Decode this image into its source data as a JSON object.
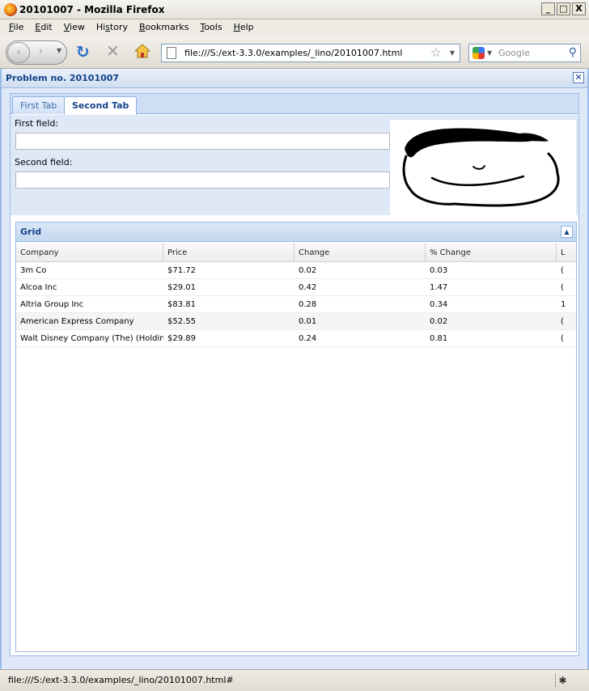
{
  "window": {
    "title": "20101007 - Mozilla Firefox",
    "controls": {
      "minimize": "_",
      "maximize": "□",
      "close": "X"
    }
  },
  "menu": {
    "items": [
      {
        "label": "File",
        "key": "F",
        "rest": "ile"
      },
      {
        "label": "Edit",
        "key": "E",
        "rest": "dit"
      },
      {
        "label": "View",
        "key": "V",
        "rest": "iew"
      },
      {
        "label": "History",
        "key": "s",
        "before": "Hi",
        "rest": "tory"
      },
      {
        "label": "Bookmarks",
        "key": "B",
        "rest": "ookmarks"
      },
      {
        "label": "Tools",
        "key": "T",
        "rest": "ools"
      },
      {
        "label": "Help",
        "key": "H",
        "rest": "elp"
      }
    ]
  },
  "toolbar": {
    "back_icon": "‹",
    "forward_icon": "›",
    "dropdown_icon": "▼",
    "reload_icon": "↻",
    "stop_icon": "✕",
    "url": "file:///S:/ext-3.3.0/examples/_lino/20101007.html",
    "star_icon": "☆",
    "url_dropdown_icon": "▼",
    "search_placeholder": "Google",
    "search_icon": "⚲"
  },
  "ext_window": {
    "title": "Problem no. 20101007",
    "close_icon": "✕",
    "tabs": [
      {
        "label": "First Tab",
        "active": false
      },
      {
        "label": "Second Tab",
        "active": true
      }
    ],
    "form": {
      "first_label": "First field:",
      "first_value": "",
      "second_label": "Second field:",
      "second_value": ""
    },
    "grid": {
      "title": "Grid",
      "collapse_icon": "▲",
      "columns": [
        "Company",
        "Price",
        "Change",
        "% Change",
        "L"
      ],
      "rows": [
        [
          "3m Co",
          "$71.72",
          "0.02",
          "0.03",
          "("
        ],
        [
          "Alcoa Inc",
          "$29.01",
          "0.42",
          "1.47",
          "("
        ],
        [
          "Altria Group Inc",
          "$83.81",
          "0.28",
          "0.34",
          "1"
        ],
        [
          "American Express Company",
          "$52.55",
          "0.01",
          "0.02",
          "("
        ],
        [
          "Walt Disney Company (The) (Holding",
          "$29.89",
          "0.24",
          "0.81",
          "("
        ]
      ]
    }
  },
  "status": {
    "text": "file:///S:/ext-3.3.0/examples/_lino/20101007.html#",
    "icon": "✱"
  }
}
